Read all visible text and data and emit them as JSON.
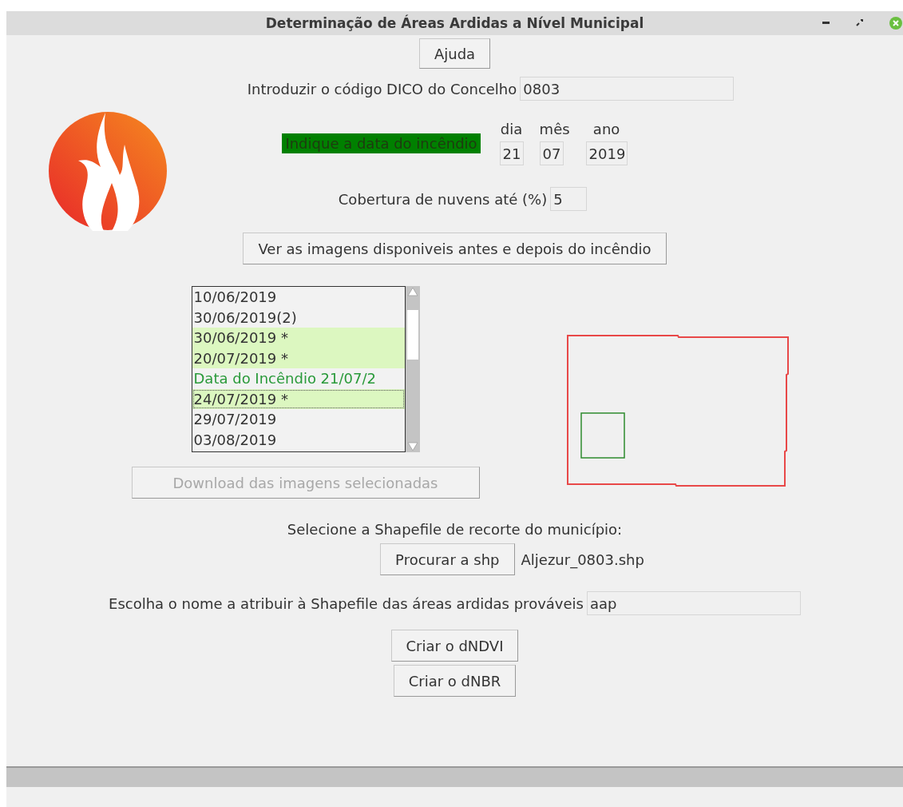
{
  "window": {
    "title": "Determinação de Áreas Ardidas a Nível Municipal"
  },
  "help_button": "Ajuda",
  "dico": {
    "label": "Introduzir o código DICO do Concelho",
    "value": "0803"
  },
  "date": {
    "label": "Indique a data do incêndio",
    "fields": [
      {
        "label": "dia",
        "value": "21"
      },
      {
        "label": "mês",
        "value": "07"
      },
      {
        "label": "ano",
        "value": "2019"
      }
    ]
  },
  "cloud": {
    "label": "Cobertura de nuvens até (%)",
    "value": "5"
  },
  "show_images_button": "Ver as imagens disponiveis antes e depois do incêndio",
  "image_list": [
    {
      "text": "10/06/2019",
      "kind": "date",
      "selected": false,
      "focused": false
    },
    {
      "text": "30/06/2019(2)",
      "kind": "date",
      "selected": false,
      "focused": false
    },
    {
      "text": "30/06/2019 *",
      "kind": "date",
      "selected": true,
      "focused": false
    },
    {
      "text": "20/07/2019 *",
      "kind": "date",
      "selected": true,
      "focused": false
    },
    {
      "text": "Data do Incêndio 21/07/2",
      "kind": "fire",
      "selected": false,
      "focused": false
    },
    {
      "text": "24/07/2019 *",
      "kind": "date",
      "selected": true,
      "focused": true
    },
    {
      "text": "29/07/2019",
      "kind": "date",
      "selected": false,
      "focused": false
    },
    {
      "text": "03/08/2019",
      "kind": "date",
      "selected": false,
      "focused": false
    }
  ],
  "download_button": {
    "label": "Download das imagens selecionadas",
    "disabled": true
  },
  "shapefile": {
    "label": "Selecione a Shapefile de recorte do município:",
    "button": "Procurar a shp",
    "file": "Aljezur_0803.shp"
  },
  "output_name": {
    "label": "Escolha o nome a atribuir à Shapefile das áreas ardidas prováveis",
    "value": "aap"
  },
  "actions": [
    "Criar o dNDVI",
    "Criar o dNBR"
  ]
}
